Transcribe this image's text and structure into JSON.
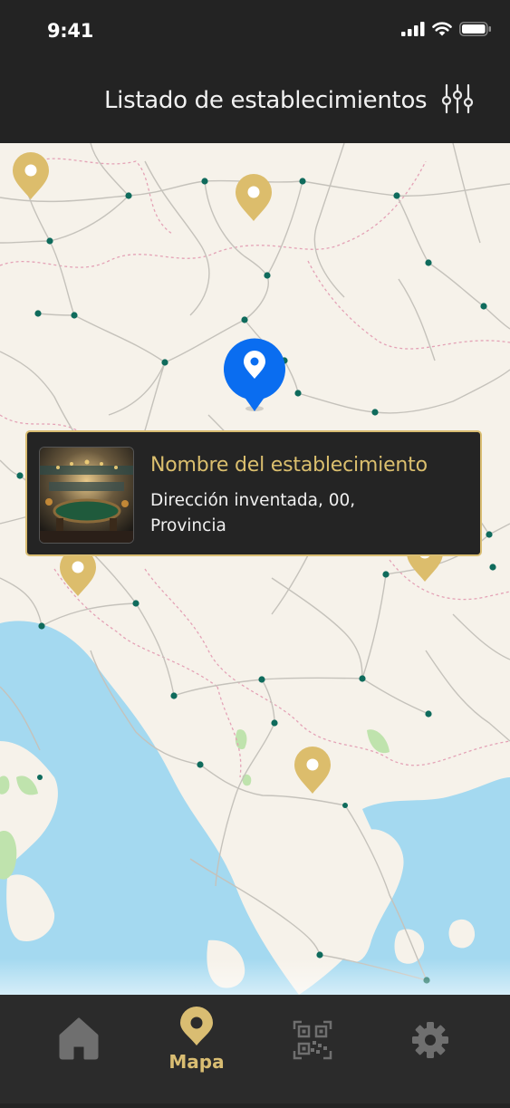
{
  "status_bar": {
    "time": "9:41",
    "icons": [
      "signal-icon",
      "wifi-icon",
      "battery-icon"
    ]
  },
  "header": {
    "title": "Listado de establecimientos",
    "filter_icon": "sliders-icon"
  },
  "map": {
    "selected_pin_color": "#0a6df0",
    "pin_color": "#dcbd6c",
    "dot_color": "#0f6b5c",
    "water_color": "#a4d9f0",
    "land_color": "#f6f2ea"
  },
  "establishment_card": {
    "name": "Nombre del establecimiento",
    "address_line1": "Dirección inventada, 00,",
    "address_line2": "Provincia",
    "image": "casino-room-thumbnail"
  },
  "tab_bar": {
    "active_color": "#d9bd72",
    "inactive_color": "#6f6f6f",
    "tabs": [
      {
        "icon": "home-icon",
        "label": ""
      },
      {
        "icon": "map-pin-icon",
        "label": "Mapa"
      },
      {
        "icon": "qr-code-icon",
        "label": ""
      },
      {
        "icon": "gear-icon",
        "label": ""
      }
    ]
  }
}
